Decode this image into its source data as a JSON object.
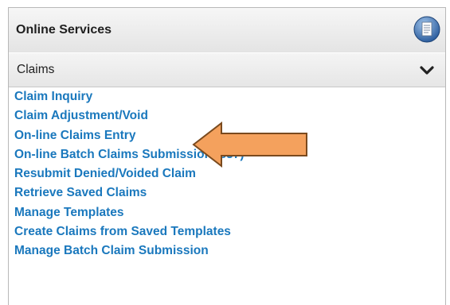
{
  "header": {
    "title": "Online Services",
    "icon": "document-icon"
  },
  "section": {
    "title": "Claims",
    "icon": "chevron-down-icon"
  },
  "links": [
    "Claim Inquiry",
    "Claim Adjustment/Void",
    "On-line Claims Entry",
    "On-line Batch Claims Submission (837)",
    "Resubmit Denied/Voided Claim",
    "Retrieve Saved Claims",
    "Manage Templates",
    "Create Claims from Saved Templates",
    "Manage Batch Claim Submission"
  ],
  "colors": {
    "link": "#1a78bd",
    "arrow": "#f4a15d",
    "arrow_border": "#7a4a1e"
  }
}
